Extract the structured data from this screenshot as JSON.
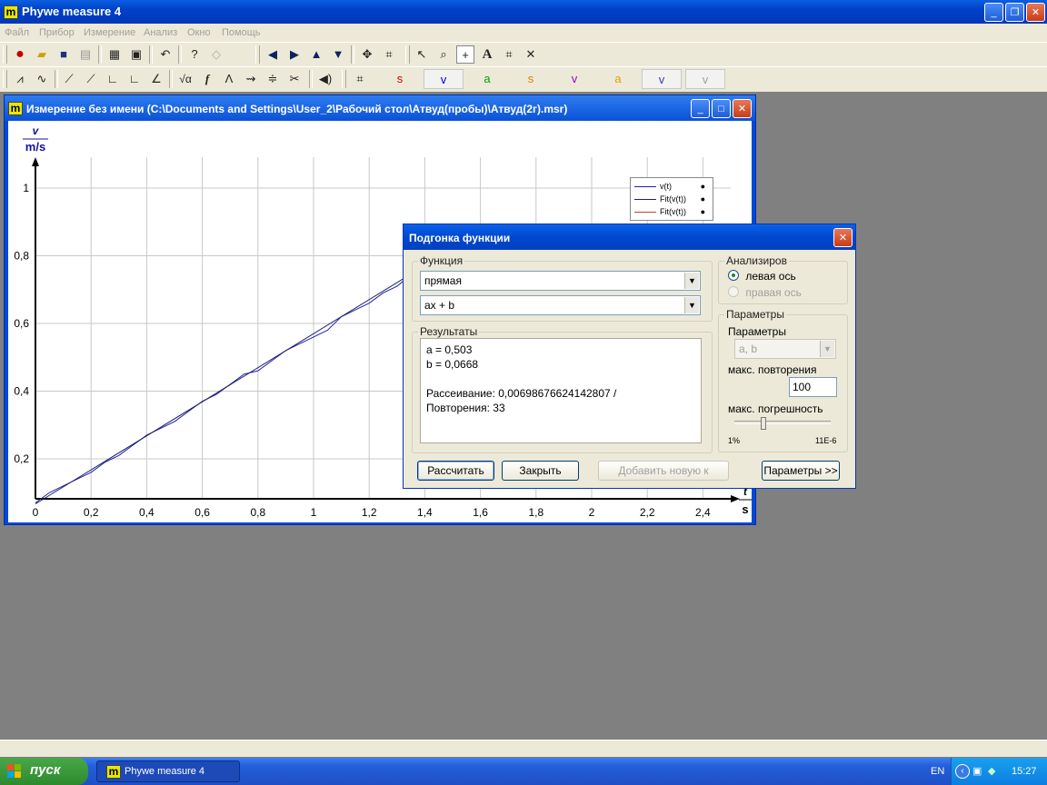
{
  "app": {
    "title": "Phywe measure 4",
    "logo": "m"
  },
  "menu": [
    "Файл",
    "Прибор",
    "Измерение",
    "Анализ",
    "Окно",
    "Помощь"
  ],
  "channels": [
    {
      "label": "s",
      "color": "#d00000"
    },
    {
      "label": "v",
      "color": "#0000d0"
    },
    {
      "label": "a",
      "color": "#00a000"
    },
    {
      "label": "s",
      "color": "#e08000"
    },
    {
      "label": "v",
      "color": "#a000c0"
    },
    {
      "label": "a",
      "color": "#e0a000"
    },
    {
      "label": "v",
      "color": "#4040a0"
    },
    {
      "label": "v",
      "color": "#a0a0a0"
    }
  ],
  "child": {
    "title": "Измерение без имени (C:\\Documents and Settings\\User_2\\Рабочий стол\\Атвуд(пробы)\\Атвуд(2г).msr)"
  },
  "chart_data": {
    "type": "line",
    "ylabel": "v",
    "yunit": "m/s",
    "xlabel": "t",
    "xunit": "s",
    "xlim": [
      0,
      2.5
    ],
    "ylim": [
      0.08,
      1.08
    ],
    "xticks": [
      "0",
      "0,2",
      "0,4",
      "0,6",
      "0,8",
      "1",
      "1,2",
      "1,4",
      "1,6",
      "1,8",
      "2",
      "2,2",
      "2,4"
    ],
    "yticks": [
      "0,2",
      "0,4",
      "0,6",
      "0,8",
      "1"
    ],
    "grid": true,
    "legend": {
      "position": "top-right",
      "entries": [
        "v(t)",
        "Fit(v(t))",
        "Fit(v(t))"
      ]
    },
    "series": [
      {
        "name": "v(t)",
        "color": "#2020b0",
        "x": [
          0,
          0.05,
          0.1,
          0.15,
          0.2,
          0.25,
          0.3,
          0.35,
          0.4,
          0.45,
          0.5,
          0.55,
          0.6,
          0.65,
          0.7,
          0.75,
          0.8,
          0.85,
          0.9,
          0.95,
          1.0,
          1.05,
          1.1,
          1.15,
          1.2,
          1.25,
          1.3,
          1.33
        ],
        "y": [
          0.07,
          0.1,
          0.12,
          0.14,
          0.16,
          0.19,
          0.21,
          0.24,
          0.27,
          0.29,
          0.31,
          0.34,
          0.37,
          0.39,
          0.42,
          0.45,
          0.46,
          0.49,
          0.52,
          0.54,
          0.56,
          0.58,
          0.62,
          0.64,
          0.66,
          0.69,
          0.71,
          0.73
        ]
      },
      {
        "name": "Fit(v(t))",
        "color": "#202060",
        "x": [
          0,
          1.33
        ],
        "y": [
          0.0668,
          0.7358
        ]
      }
    ]
  },
  "dialog": {
    "title": "Подгонка функции",
    "function_group": "Функция",
    "function_type": "прямая",
    "function_formula": "ax + b",
    "results_group": "Результаты",
    "result_a": "a = 0,503",
    "result_b": "b = 0,0668",
    "result_dispersion": "Рассеивание: 0,00698676624142807  /",
    "result_iterations": "Повторения: 33",
    "analyze_group": "Анализиров",
    "left_axis": "левая ось",
    "right_axis": "правая ось",
    "params_group": "Параметры",
    "params_label": "Параметры",
    "params_value": "a, b",
    "max_iter_label": "макс. повторения",
    "max_iter_value": "100",
    "max_error_label": "макс. погрешность",
    "slider_min": "1%",
    "slider_max": "11E-6",
    "btn_calc": "Рассчитать",
    "btn_close": "Закрыть",
    "btn_add": "Добавить новую к",
    "btn_params": "Параметры >>"
  },
  "taskbar": {
    "start": "пуск",
    "task": "Phywe measure 4",
    "lang": "EN",
    "clock": "15:27"
  }
}
